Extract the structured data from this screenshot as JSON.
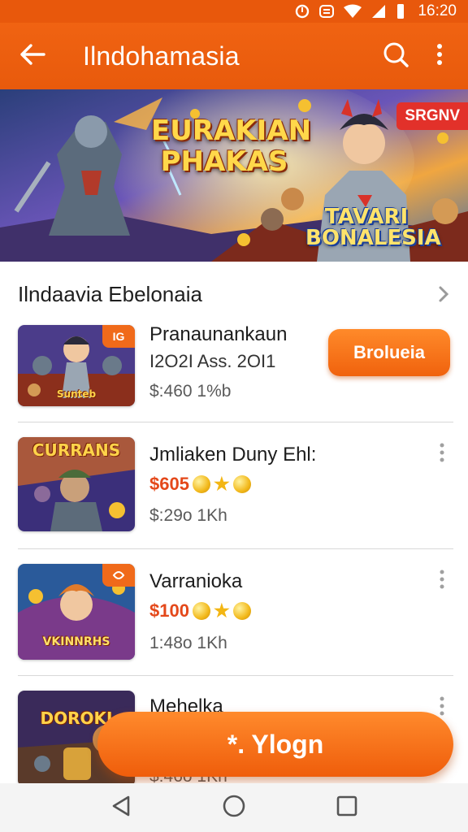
{
  "status_bar": {
    "time": "16:20"
  },
  "app_bar": {
    "title": "Ilndohamasia",
    "icons": [
      "arrow-back-icon",
      "search-icon",
      "more-vert-icon"
    ]
  },
  "banner": {
    "title": "EURAKIAN PHAKAS",
    "subtitle": "TAVARI BONALESIA",
    "tag": "SRGNV"
  },
  "section": {
    "title": "Ilndaavia Ebelonaia"
  },
  "items": [
    {
      "name": "Pranaunankaun",
      "line2": "I2O2I Ass. 2OI1",
      "meta": "$:460 1%b",
      "thumb_badge": "IG",
      "thumb_text": "Sunteb",
      "action": "Brolueia"
    },
    {
      "name": "Jmliaken Duny Ehl:",
      "price": "$605",
      "meta": "$:29o 1Kh",
      "thumb_text": "CURRANS"
    },
    {
      "name": "Varranioka",
      "price": "$100",
      "meta": "1:48o 1Kh",
      "thumb_text": "VKINNRHS"
    },
    {
      "name": "Mehelka",
      "meta": "$:46o 1Kh",
      "thumb_text": "DOROKI"
    }
  ],
  "floating_cta": {
    "label": "*. Ylogn"
  },
  "colors": {
    "primary": "#e8580c",
    "accent": "#f06a1a",
    "price": "#e4481a"
  }
}
